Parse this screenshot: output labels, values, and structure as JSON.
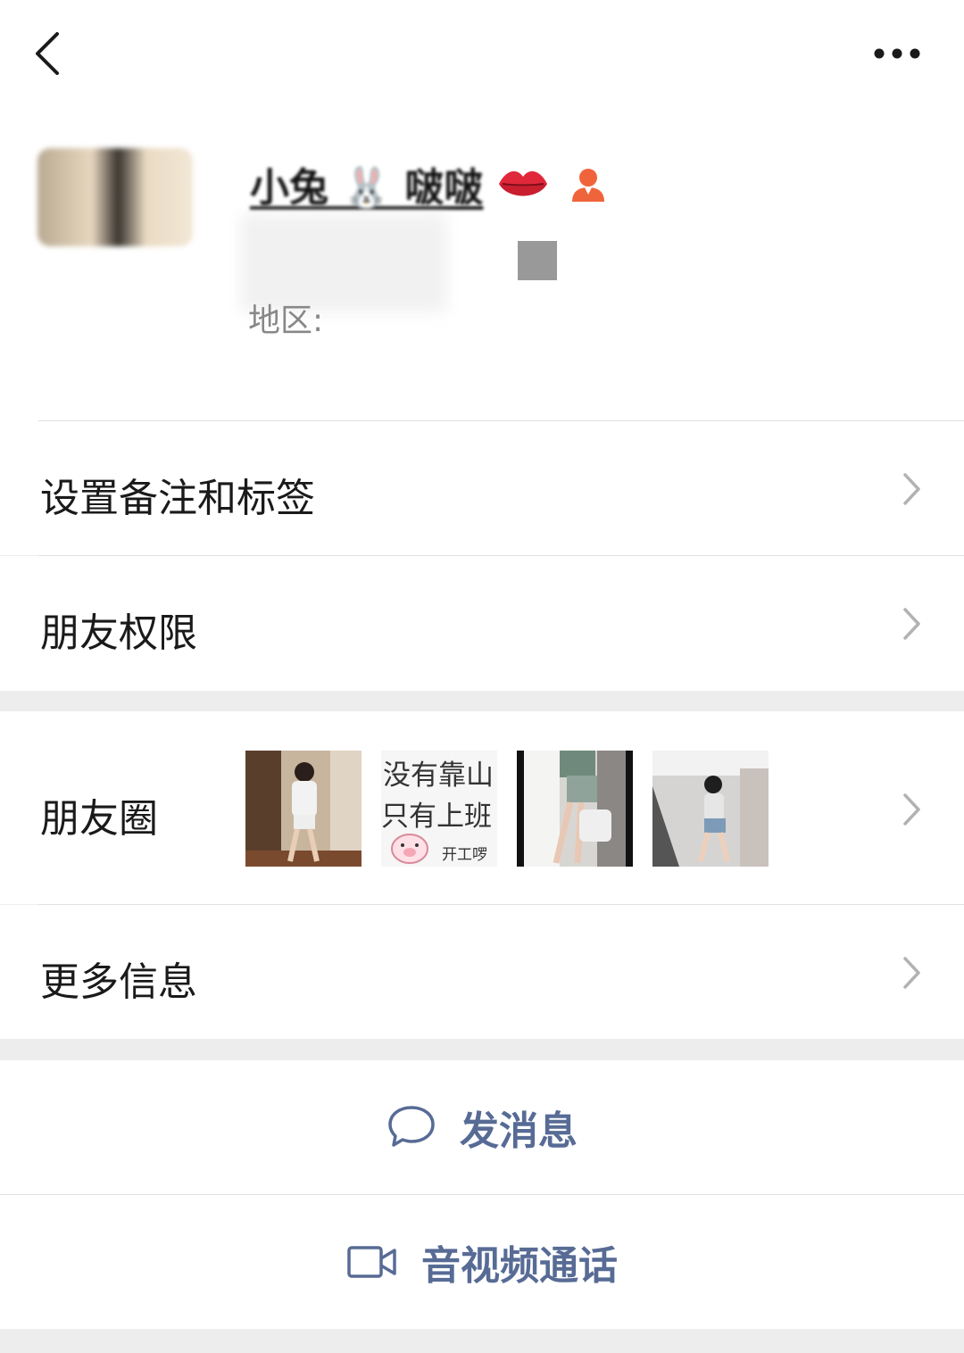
{
  "navbar": {
    "back_icon": "chevron-left-icon",
    "more_icon": "more-dots-icon"
  },
  "profile": {
    "nickname": "小兔 🐰 啵啵",
    "region_label": "地区:",
    "decor_icons": [
      "kiss-icon",
      "user-badge-icon"
    ]
  },
  "menu": {
    "remark_tags": "设置备注和标签",
    "friend_permissions": "朋友权限",
    "moments": "朋友圈",
    "more_info": "更多信息"
  },
  "moments_thumbs": [
    {
      "type": "photo"
    },
    {
      "type": "text",
      "line1": "没有靠山",
      "line2": "只有上班",
      "line3": "开工啰"
    },
    {
      "type": "photo"
    },
    {
      "type": "photo"
    }
  ],
  "actions": {
    "send_message": "发消息",
    "video_call": "音视频通话"
  },
  "colors": {
    "link_blue": "#576b95",
    "background": "#ededed",
    "card": "#ffffff",
    "divider": "#e1e1e1"
  }
}
